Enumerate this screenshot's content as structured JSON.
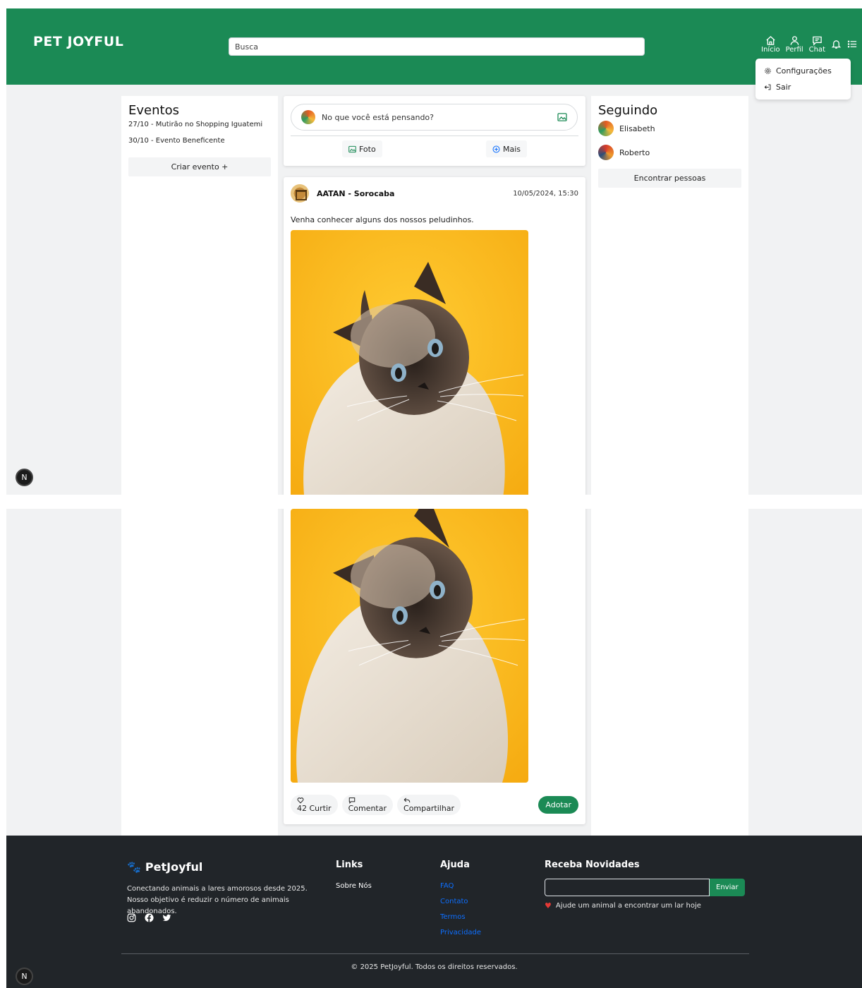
{
  "header": {
    "logo": "PET JOYFUL",
    "search_placeholder": "Busca",
    "nav": [
      {
        "label": "Início",
        "icon": "home-icon"
      },
      {
        "label": "Perfil",
        "icon": "user-icon"
      },
      {
        "label": "Chat",
        "icon": "chat-icon"
      }
    ],
    "notifications_icon": "bell-icon",
    "menu_icon": "list-icon"
  },
  "dropdown": {
    "items": [
      {
        "label": "Configurações",
        "icon": "gear-icon"
      },
      {
        "label": "Sair",
        "icon": "logout-icon"
      }
    ]
  },
  "events": {
    "title": "Eventos",
    "items": [
      "27/10 - Mutirão no Shopping Iguatemi",
      "30/10 - Evento Beneficente"
    ],
    "create_label": "Criar evento +"
  },
  "composer": {
    "placeholder": "No que você está pensando?",
    "photo_label": "Foto",
    "more_label": "Mais"
  },
  "post": {
    "author": "AATAN - Sorocaba",
    "datetime": "10/05/2024, 15:30",
    "text": "Venha conhecer alguns dos nossos peludinhos.",
    "likes_label": "42 Curtir",
    "comment_label": "Comentar",
    "share_label": "Compartilhar",
    "adopt_label": "Adotar"
  },
  "following": {
    "title": "Seguindo",
    "people": [
      "Elisabeth",
      "Roberto"
    ],
    "find_label": "Encontrar pessoas"
  },
  "footer": {
    "brand": "PetJoyful",
    "description": "Conectando animais a lares amorosos desde 2025. Nosso objetivo é reduzir o número de animais abandonados.",
    "social_icons": [
      "instagram-icon",
      "facebook-icon",
      "twitter-icon"
    ],
    "links_title": "Links",
    "links": [
      "Sobre Nós"
    ],
    "help_title": "Ajuda",
    "help_links": [
      "FAQ",
      "Contato",
      "Termos",
      "Privacidade"
    ],
    "newsletter_title": "Receba Novidades",
    "newsletter_button": "Enviar",
    "newsletter_note": "Ajude um animal a encontrar um lar hoje",
    "copyright": "© 2025 PetJoyful. Todos os direitos reservados."
  },
  "dev_badge": "N",
  "colors": {
    "brand_green": "#1b8a55",
    "footer_bg": "#212529",
    "link_blue": "#0d6efd"
  }
}
